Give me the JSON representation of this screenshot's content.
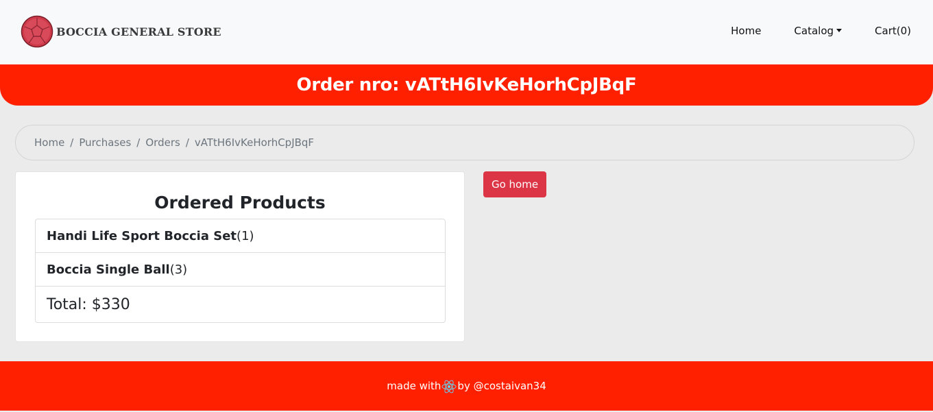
{
  "navbar": {
    "brand_name": "BOCCIA GENERAL STORE",
    "brand_icon": "boccia-ball-icon",
    "links": {
      "home": "Home",
      "catalog": "Catalog",
      "cart": "Cart(0)"
    }
  },
  "banner": {
    "title": "Order nro: vATtH6IvKeHorhCpJBqF"
  },
  "breadcrumb": {
    "items": [
      "Home",
      "Purchases",
      "Orders"
    ],
    "current": "vATtH6IvKeHorhCpJBqF",
    "separator": "/"
  },
  "order_card": {
    "title": "Ordered Products",
    "products": [
      {
        "name": "Handi Life Sport Boccia Set",
        "qty": "(1)"
      },
      {
        "name": "Boccia Single Ball",
        "qty": "(3)"
      }
    ],
    "total": "Total: $330"
  },
  "actions": {
    "go_home": "Go home"
  },
  "footer": {
    "prefix": "made with",
    "icon": "react-atom-icon",
    "suffix": "by @costaivan34"
  },
  "colors": {
    "accent_red": "#ff2000",
    "button_red": "#dc3545",
    "navbar_bg": "#f8f9fa",
    "page_bg": "#ebebeb"
  }
}
